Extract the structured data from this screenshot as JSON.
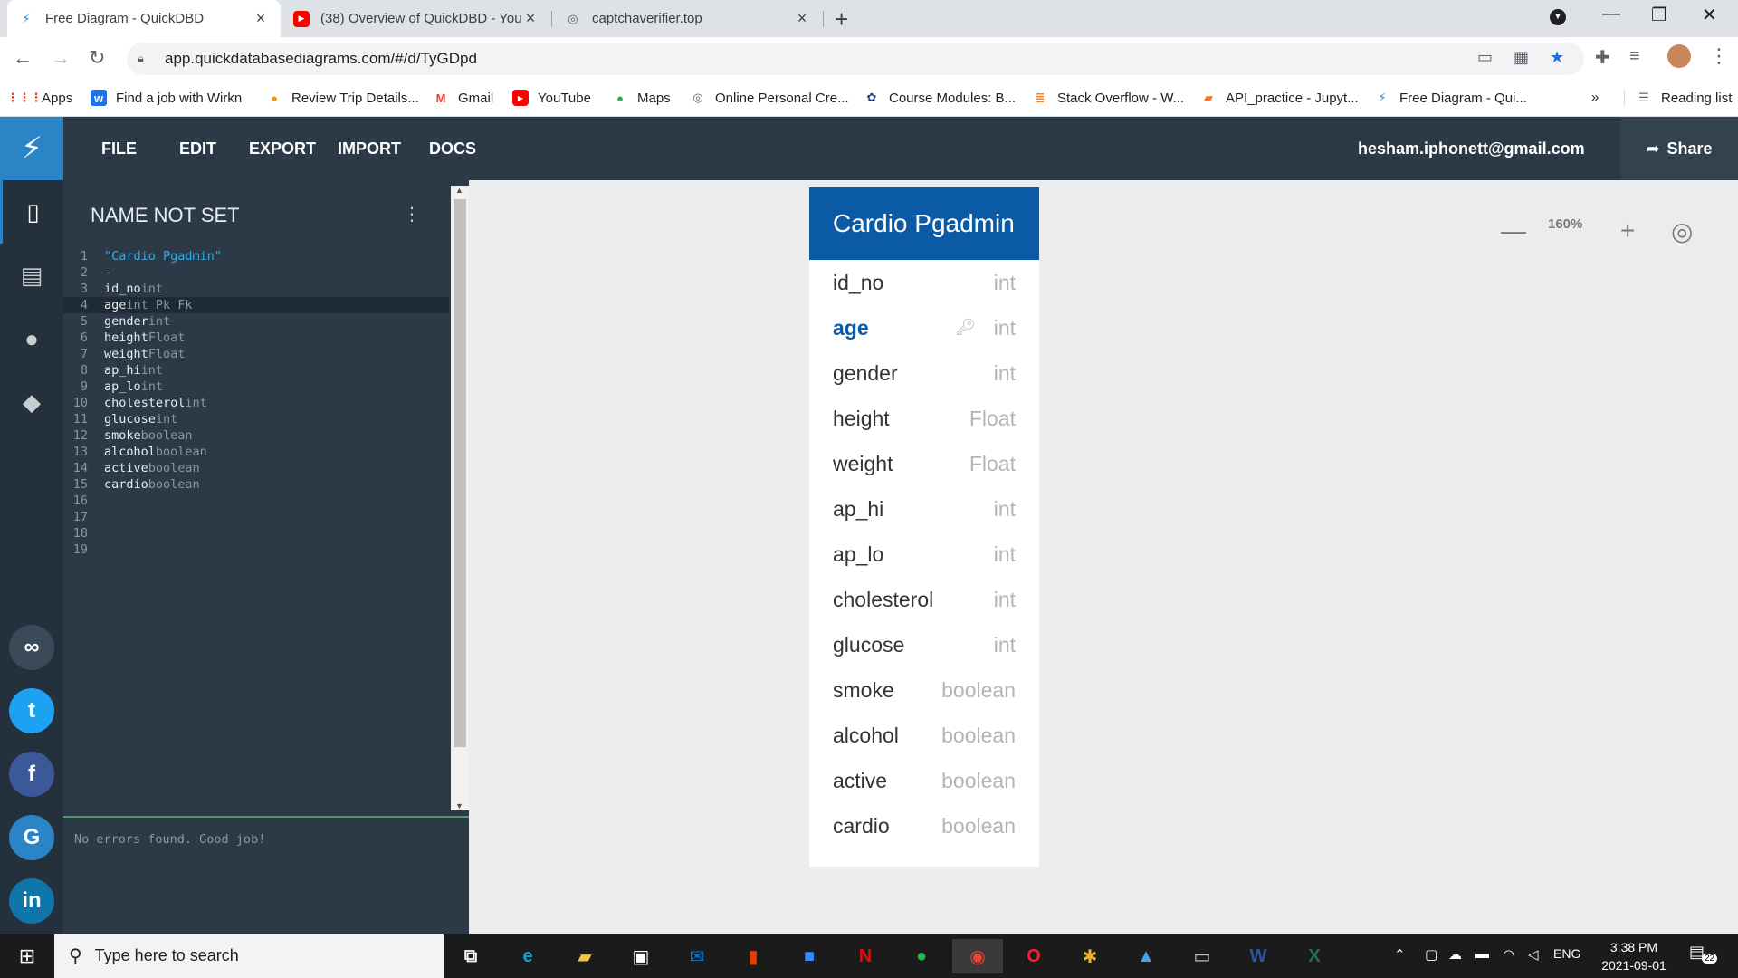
{
  "browser": {
    "tabs": [
      {
        "title": "Free Diagram - QuickDBD",
        "active": true
      },
      {
        "title": "(38) Overview of QuickDBD - You",
        "active": false
      },
      {
        "title": "captchaverifier.top",
        "active": false
      }
    ],
    "url": "app.quickdatabasediagrams.com/#/d/TyGDpd",
    "bookmarks": [
      "Apps",
      "Find a job with Wirkn",
      "Review Trip Details...",
      "Gmail",
      "YouTube",
      "Maps",
      "Online Personal Cre...",
      "Course Modules: B...",
      "Stack Overflow - W...",
      "API_practice - Jupyt...",
      "Free Diagram - Qui..."
    ],
    "bookmarks_overflow": "»",
    "reading_list": "Reading list"
  },
  "app": {
    "menu": [
      "FILE",
      "EDIT",
      "EXPORT",
      "IMPORT",
      "DOCS"
    ],
    "user_email": "hesham.iphonett@gmail.com",
    "share_label": "Share",
    "editor": {
      "title": "NAME NOT SET",
      "lines": [
        {
          "num": "1",
          "name": "\"Cardio Pgadmin\"",
          "type": "",
          "kind": "str"
        },
        {
          "num": "2",
          "name": "-",
          "type": "",
          "kind": "ty"
        },
        {
          "num": "3",
          "name": "id_no",
          "type": "int"
        },
        {
          "num": "4",
          "name": "age",
          "type": "int Pk Fk",
          "current": true
        },
        {
          "num": "5",
          "name": "gender",
          "type": "int"
        },
        {
          "num": "6",
          "name": "height",
          "type": "Float"
        },
        {
          "num": "7",
          "name": "weight",
          "type": "Float"
        },
        {
          "num": "8",
          "name": "ap_hi",
          "type": "int"
        },
        {
          "num": "9",
          "name": "ap_lo",
          "type": "int"
        },
        {
          "num": "10",
          "name": "cholesterol",
          "type": "int"
        },
        {
          "num": "11",
          "name": "glucose",
          "type": "int"
        },
        {
          "num": "12",
          "name": "smoke",
          "type": "boolean"
        },
        {
          "num": "13",
          "name": "alcohol",
          "type": "boolean"
        },
        {
          "num": "14",
          "name": "active",
          "type": "boolean"
        },
        {
          "num": "15",
          "name": "cardio",
          "type": "boolean"
        },
        {
          "num": "16",
          "name": "",
          "type": ""
        },
        {
          "num": "17",
          "name": "",
          "type": ""
        },
        {
          "num": "18",
          "name": "",
          "type": ""
        },
        {
          "num": "19",
          "name": "",
          "type": ""
        }
      ],
      "status": "No errors found. Good job!"
    },
    "zoom": "160%",
    "diagram": {
      "table_name": "Cardio Pgadmin",
      "fields": [
        {
          "name": "id_no",
          "type": "int"
        },
        {
          "name": "age",
          "type": "int",
          "pk": true
        },
        {
          "name": "gender",
          "type": "int"
        },
        {
          "name": "height",
          "type": "Float"
        },
        {
          "name": "weight",
          "type": "Float"
        },
        {
          "name": "ap_hi",
          "type": "int"
        },
        {
          "name": "ap_lo",
          "type": "int"
        },
        {
          "name": "cholesterol",
          "type": "int"
        },
        {
          "name": "glucose",
          "type": "int"
        },
        {
          "name": "smoke",
          "type": "boolean"
        },
        {
          "name": "alcohol",
          "type": "boolean"
        },
        {
          "name": "active",
          "type": "boolean"
        },
        {
          "name": "cardio",
          "type": "boolean"
        }
      ]
    }
  },
  "taskbar": {
    "search_placeholder": "Type here to search",
    "language": "ENG",
    "time": "3:38 PM",
    "date": "2021-09-01",
    "notifications": "22"
  },
  "colors": {
    "header": "#2c3a47",
    "accent": "#2b84c5",
    "table_header": "#0b5aa6"
  }
}
